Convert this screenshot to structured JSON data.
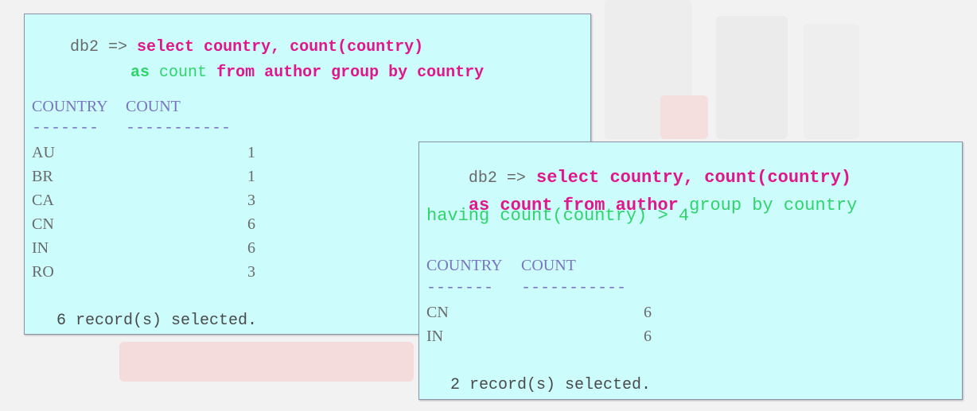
{
  "colors": {
    "panel_bg": "#ccfcfc",
    "keyword_pink": "#e0168c",
    "keyword_green": "#2fd46a",
    "header_purple": "#7a74c0",
    "text_gray": "#6a6a6a"
  },
  "query1": {
    "prompt": "db2 =>",
    "line1_kw": "select country, count(country)",
    "line2_as": "as",
    "line2_count": "count",
    "line2_rest": "from author group by country",
    "col_country": "COUNTRY",
    "col_count": "COUNT",
    "sep_country": "-------",
    "sep_count": "-----------",
    "rows": [
      {
        "country": "AU",
        "count": "1"
      },
      {
        "country": "BR",
        "count": "1"
      },
      {
        "country": "CA",
        "count": "3"
      },
      {
        "country": "CN",
        "count": "6"
      },
      {
        "country": "IN",
        "count": "6"
      },
      {
        "country": "RO",
        "count": "3"
      }
    ],
    "footer": "6 record(s) selected."
  },
  "query2": {
    "prompt": "db2 =>",
    "line1_kw": "select country, count(country)",
    "line2_kw": "as count from author",
    "line2_green": "group by country",
    "line3": "having count(country) > 4",
    "col_country": "COUNTRY",
    "col_count": "COUNT",
    "sep_country": "-------",
    "sep_count": "-----------",
    "rows": [
      {
        "country": "CN",
        "count": "6"
      },
      {
        "country": "IN",
        "count": "6"
      }
    ],
    "footer": "2 record(s) selected."
  }
}
